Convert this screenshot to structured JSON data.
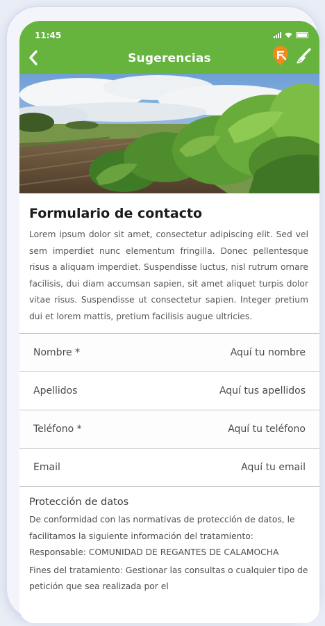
{
  "status_bar": {
    "time": "11:45"
  },
  "header": {
    "title": "Sugerencias",
    "back_icon": "back-chevron-icon",
    "location_icon": "location-pin-icon",
    "brush_icon": "brush-icon",
    "accent_color": "#66b43d",
    "location_color": "#f08a1c"
  },
  "form": {
    "title": "Formulario de contacto",
    "description": "Lorem ipsum dolor sit amet, consectetur adipiscing elit. Sed vel sem imperdiet nunc elementum fringilla. Donec pellentesque risus a aliquam imperdiet. Suspendisse luctus, nisl rutrum ornare facilisis, dui diam accumsan sapien, sit amet aliquet turpis dolor vitae risus. Suspendisse ut consectetur sapien. Integer pretium dui et lorem mattis, pretium facilisis augue ultricies.",
    "fields": [
      {
        "label": "Nombre *",
        "placeholder": "Aquí tu nombre",
        "value": ""
      },
      {
        "label": "Apellidos",
        "placeholder": "Aquí tus apellidos",
        "value": ""
      },
      {
        "label": "Teléfono *",
        "placeholder": "Aquí tu teléfono",
        "value": ""
      },
      {
        "label": "Email",
        "placeholder": "Aquí tu email",
        "value": ""
      }
    ]
  },
  "privacy": {
    "title": "Protección de datos",
    "paragraph1": "De conformidad con las normativas de protección de datos, le facilitamos la siguiente información del tratamiento: Responsable: COMUNIDAD DE REGANTES DE CALAMOCHA",
    "paragraph2": "Fines del tratamiento: Gestionar las consultas o cualquier tipo de petición que sea realizada por el"
  }
}
